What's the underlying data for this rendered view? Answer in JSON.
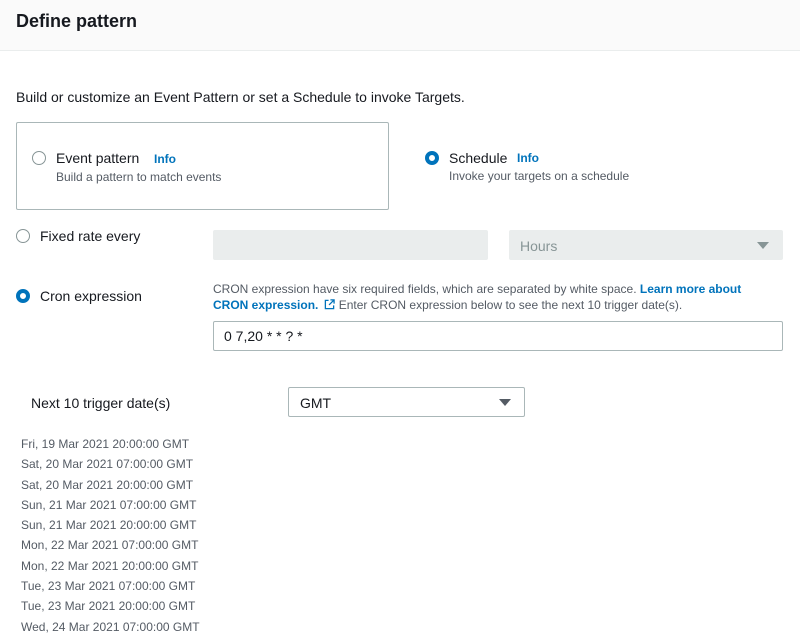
{
  "page": {
    "title": "Define pattern"
  },
  "intro": "Build or customize an Event Pattern or set a Schedule to invoke Targets.",
  "event_pattern": {
    "label": "Event pattern",
    "info": "Info",
    "description": "Build a pattern to match events",
    "selected": false
  },
  "schedule": {
    "label": "Schedule",
    "info": "Info",
    "description": "Invoke your targets on a schedule",
    "selected": true
  },
  "fixed_rate": {
    "label": "Fixed rate every",
    "value": "",
    "unit": "Hours",
    "selected": false
  },
  "cron": {
    "label": "Cron expression",
    "selected": true,
    "help_text": "CRON expression have six required fields, which are separated by white space.",
    "learn_more_link": "Learn more about CRON expression.",
    "help_text_after": "Enter CRON expression below to see the next 10 trigger date(s).",
    "value": "0 7,20 * * ? *"
  },
  "next_triggers": {
    "label": "Next 10 trigger date(s)",
    "timezone": "GMT",
    "dates": [
      "Fri, 19 Mar 2021 20:00:00 GMT",
      "Sat, 20 Mar 2021 07:00:00 GMT",
      "Sat, 20 Mar 2021 20:00:00 GMT",
      "Sun, 21 Mar 2021 07:00:00 GMT",
      "Sun, 21 Mar 2021 20:00:00 GMT",
      "Mon, 22 Mar 2021 07:00:00 GMT",
      "Mon, 22 Mar 2021 20:00:00 GMT",
      "Tue, 23 Mar 2021 07:00:00 GMT",
      "Tue, 23 Mar 2021 20:00:00 GMT",
      "Wed, 24 Mar 2021 07:00:00 GMT"
    ]
  },
  "colors": {
    "accent": "#0073bb",
    "text": "#16191f",
    "muted": "#545b64",
    "border": "#aab7b8",
    "disabled_bg": "#eaeded"
  },
  "icons": {
    "external_link": "external-link-icon",
    "dropdown": "caret-down-icon"
  }
}
